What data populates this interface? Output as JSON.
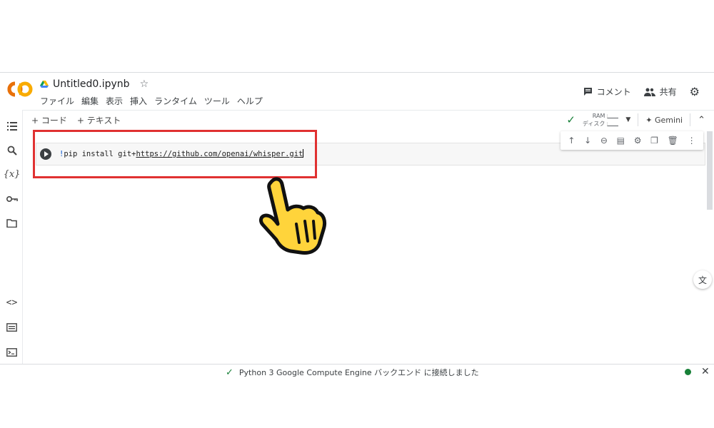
{
  "app": {
    "logo_text": "CO",
    "title": "Untitled0.ipynb",
    "menu": [
      "ファイル",
      "編集",
      "表示",
      "挿入",
      "ランタイム",
      "ツール",
      "ヘルプ"
    ],
    "comment_label": "コメント",
    "share_label": "共有"
  },
  "toolbar": {
    "add_code": "+ コード",
    "add_text": "+ テキスト",
    "ram_label": "RAM",
    "disk_label": "ディスク",
    "gemini_label": "Gemini"
  },
  "cell": {
    "code_bang": "!",
    "code_prefix": "pip install git+",
    "code_url": "https://github.com/openai/whisper.git"
  },
  "status": {
    "message": "Python 3 Google Compute Engine バックエンド に接続しました"
  },
  "colors": {
    "highlight_box": "#e03131",
    "connected": "#188038",
    "logo_orange": "#f9ab00"
  },
  "icons": {
    "sidebar": [
      "toc-icon",
      "search-icon",
      "variables-icon",
      "secrets-icon",
      "folder-icon",
      "code-snippets-icon",
      "command-palette-icon",
      "terminal-icon"
    ],
    "cell_toolbar": [
      "arrow-up-icon",
      "arrow-down-icon",
      "link-icon",
      "comment-icon",
      "settings-icon",
      "mirror-cell-icon",
      "delete-icon",
      "more-icon"
    ]
  }
}
